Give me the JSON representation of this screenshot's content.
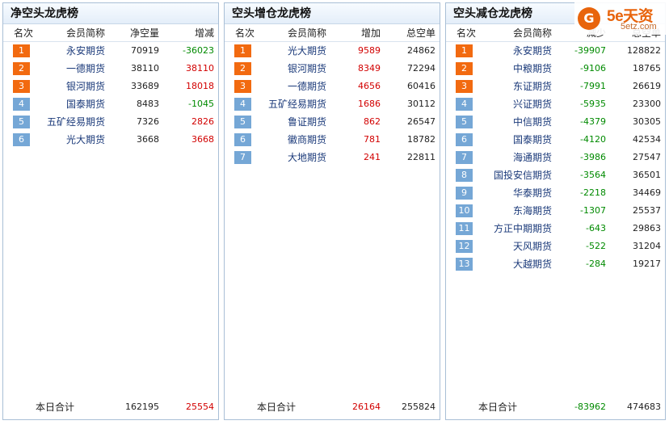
{
  "colors": {
    "accent": "#f26a10",
    "rank_other": "#75a7d6",
    "increase": "#d20000",
    "decrease": "#008a00",
    "member_name": "#1b3a7a"
  },
  "panels": [
    {
      "title": "净空头龙虎榜",
      "headers": [
        "名次",
        "会员简称",
        "净空量",
        "增减"
      ],
      "rows": [
        {
          "rank": "1",
          "name": "永安期货",
          "v1": "70919",
          "v2": "-36023"
        },
        {
          "rank": "2",
          "name": "一德期货",
          "v1": "38110",
          "v2": "38110"
        },
        {
          "rank": "3",
          "name": "银河期货",
          "v1": "33689",
          "v2": "18018"
        },
        {
          "rank": "4",
          "name": "国泰期货",
          "v1": "8483",
          "v2": "-1045"
        },
        {
          "rank": "5",
          "name": "五矿经易期货",
          "v1": "7326",
          "v2": "2826"
        },
        {
          "rank": "6",
          "name": "光大期货",
          "v1": "3668",
          "v2": "3668"
        }
      ],
      "total": {
        "label": "本日合计",
        "v1": "162195",
        "v2": "25554"
      }
    },
    {
      "title": "空头增仓龙虎榜",
      "headers": [
        "名次",
        "会员简称",
        "增加",
        "总空单"
      ],
      "rows": [
        {
          "rank": "1",
          "name": "光大期货",
          "v1": "9589",
          "v2": "24862"
        },
        {
          "rank": "2",
          "name": "银河期货",
          "v1": "8349",
          "v2": "72294"
        },
        {
          "rank": "3",
          "name": "一德期货",
          "v1": "4656",
          "v2": "60416"
        },
        {
          "rank": "4",
          "name": "五矿经易期货",
          "v1": "1686",
          "v2": "30112"
        },
        {
          "rank": "5",
          "name": "鲁证期货",
          "v1": "862",
          "v2": "26547"
        },
        {
          "rank": "6",
          "name": "徽商期货",
          "v1": "781",
          "v2": "18782"
        },
        {
          "rank": "7",
          "name": "大地期货",
          "v1": "241",
          "v2": "22811"
        }
      ],
      "total": {
        "label": "本日合计",
        "v1": "26164",
        "v2": "255824"
      }
    },
    {
      "title": "空头减仓龙虎榜",
      "headers": [
        "名次",
        "会员简称",
        "减少",
        "总空单"
      ],
      "rows": [
        {
          "rank": "1",
          "name": "永安期货",
          "v1": "-39907",
          "v2": "128822"
        },
        {
          "rank": "2",
          "name": "中粮期货",
          "v1": "-9106",
          "v2": "18765"
        },
        {
          "rank": "3",
          "name": "东证期货",
          "v1": "-7991",
          "v2": "26619"
        },
        {
          "rank": "4",
          "name": "兴证期货",
          "v1": "-5935",
          "v2": "23300"
        },
        {
          "rank": "5",
          "name": "中信期货",
          "v1": "-4379",
          "v2": "30305"
        },
        {
          "rank": "6",
          "name": "国泰期货",
          "v1": "-4120",
          "v2": "42534"
        },
        {
          "rank": "7",
          "name": "海通期货",
          "v1": "-3986",
          "v2": "27547"
        },
        {
          "rank": "8",
          "name": "国投安信期货",
          "v1": "-3564",
          "v2": "36501"
        },
        {
          "rank": "9",
          "name": "华泰期货",
          "v1": "-2218",
          "v2": "34469"
        },
        {
          "rank": "10",
          "name": "东海期货",
          "v1": "-1307",
          "v2": "25537"
        },
        {
          "rank": "11",
          "name": "方正中期期货",
          "v1": "-643",
          "v2": "29863"
        },
        {
          "rank": "12",
          "name": "天风期货",
          "v1": "-522",
          "v2": "31204"
        },
        {
          "rank": "13",
          "name": "大越期货",
          "v1": "-284",
          "v2": "19217"
        }
      ],
      "total": {
        "label": "本日合计",
        "v1": "-83962",
        "v2": "474683"
      }
    }
  ],
  "logo": {
    "main": "5e天资",
    "sub": "5etz.com",
    "mark": "G"
  }
}
